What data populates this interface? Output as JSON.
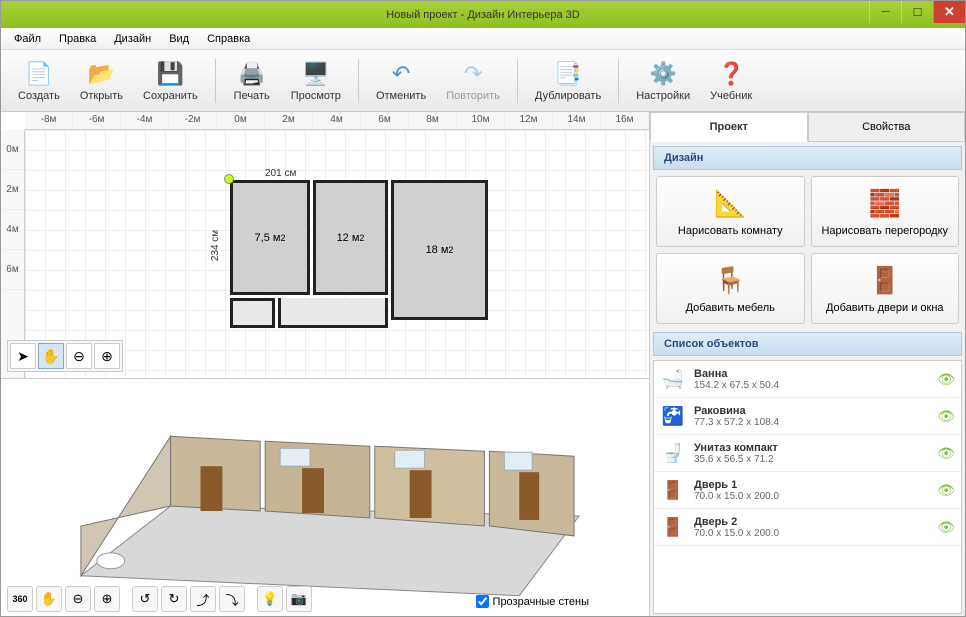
{
  "window": {
    "title": "Новый проект - Дизайн Интерьера 3D"
  },
  "menu": {
    "file": "Файл",
    "edit": "Правка",
    "design": "Дизайн",
    "view": "Вид",
    "help": "Справка"
  },
  "toolbar": {
    "create": "Создать",
    "open": "Открыть",
    "save": "Сохранить",
    "print": "Печать",
    "preview": "Просмотр",
    "undo": "Отменить",
    "redo": "Повторить",
    "duplicate": "Дублировать",
    "settings": "Настройки",
    "tutorial": "Учебник"
  },
  "ruler_h": [
    "-8м",
    "-6м",
    "-4м",
    "-2м",
    "0м",
    "2м",
    "4м",
    "6м",
    "8м",
    "10м",
    "12м",
    "14м",
    "16м"
  ],
  "ruler_v": [
    "0м",
    "2м",
    "4м",
    "6м"
  ],
  "plan": {
    "dim_w": "201 см",
    "dim_h": "234 см",
    "room1": "7,5 м",
    "room2": "12 м",
    "room3": "18 м",
    "sup2": "2"
  },
  "tabs": {
    "project": "Проект",
    "properties": "Свойства"
  },
  "section": {
    "design": "Дизайн",
    "objects": "Список объектов"
  },
  "design_buttons": {
    "draw_room": "Нарисовать комнату",
    "draw_wall": "Нарисовать перегородку",
    "add_furniture": "Добавить мебель",
    "add_doors": "Добавить двери и окна"
  },
  "objects": [
    {
      "name": "Ванна",
      "dims": "154.2 x 67.5 x 50.4",
      "icon": "🛁"
    },
    {
      "name": "Раковина",
      "dims": "77.3 x 57.2 x 108.4",
      "icon": "🚰"
    },
    {
      "name": "Унитаз компакт",
      "dims": "35.6 x 56.5 x 71.2",
      "icon": "🚽"
    },
    {
      "name": "Дверь 1",
      "dims": "70.0 x 15.0 x 200.0",
      "icon": "🚪"
    },
    {
      "name": "Дверь 2",
      "dims": "70.0 x 15.0 x 200.0",
      "icon": "🚪"
    }
  ],
  "checkbox": {
    "transparent": "Прозрачные стены"
  }
}
